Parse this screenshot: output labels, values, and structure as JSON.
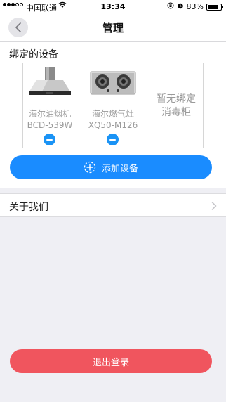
{
  "status_bar": {
    "carrier": "中国联通",
    "time": "13:34",
    "battery": "83%",
    "battery_level": 0.83
  },
  "nav": {
    "title": "管理",
    "back_icon": "back-chevron-icon"
  },
  "bound_devices": {
    "section_title": "绑定的设备",
    "devices": [
      {
        "name": "海尔油烟机",
        "model": "BCD-539W",
        "image": "range-hood-image"
      },
      {
        "name": "海尔燃气灶",
        "model": "XQ50-M126",
        "image": "gas-stove-image"
      }
    ],
    "empty_slot_text": [
      "暂无绑定",
      "消毒柜"
    ],
    "add_button_label": "添加设备"
  },
  "menu": {
    "about_label": "关于我们"
  },
  "logout": {
    "label": "退出登录"
  },
  "colors": {
    "primary_blue": "#1a8cff",
    "logout_red": "#f0555e",
    "background": "#efeff4"
  }
}
